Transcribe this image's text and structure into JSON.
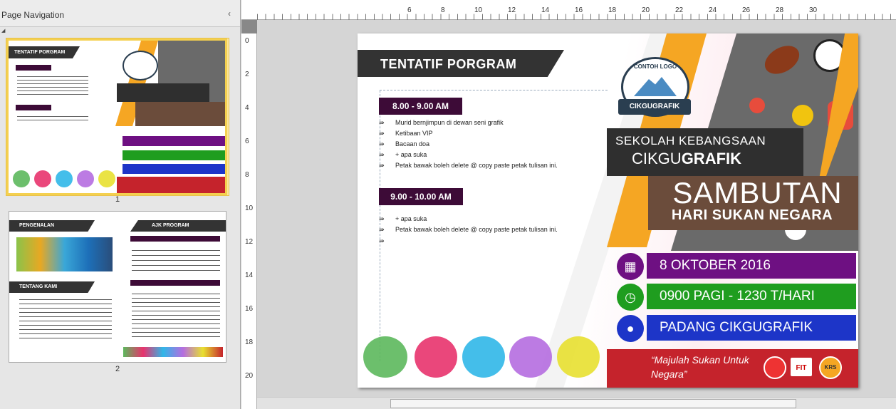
{
  "nav": {
    "title": "Page Navigation",
    "close": "‹",
    "page1": "1",
    "page2": "2"
  },
  "ruler": {
    "h": [
      "6",
      "8",
      "10",
      "12",
      "14",
      "16",
      "18",
      "20",
      "22",
      "24",
      "26",
      "28",
      "30"
    ],
    "v": [
      "0",
      "2",
      "4",
      "6",
      "8",
      "10",
      "12",
      "14",
      "16",
      "18",
      "20"
    ]
  },
  "doc": {
    "header": "TENTATIF PORGRAM",
    "slot1": {
      "time": "8.00 - 9.00 AM",
      "items": [
        "Murid bernjimpun di dewan seni grafik",
        "Ketibaan VIP",
        "Bacaan doa",
        "+ apa suka",
        "Petak bawak boleh delete @ copy paste petak tulisan ini."
      ]
    },
    "slot2": {
      "time": "9.00 - 10.00 AM",
      "items": [
        "+ apa suka",
        "Petak bawak boleh delete @ copy paste petak tulisan ini."
      ]
    },
    "logo_top": "CONTOH LOGO",
    "logo_name": "CIKGUGRAFIK",
    "school1": "SEKOLAH KEBANGSAAN",
    "school2a": "CIKGU",
    "school2b": "GRAFIK",
    "title1": "SAMBUTAN",
    "title2": "HARI SUKAN NEGARA",
    "date": "8 OKTOBER 2016",
    "time": "0900 PAGI  - 1230 T/HARI",
    "place": "PADANG CIKGUGRAFIK",
    "quote": "“Majulah Sukan Untuk Negara”",
    "sponsor_fit": "FIT",
    "sponsor_krs": "KRS"
  },
  "thumb2": {
    "h1": "PENGENALAN",
    "h2": "AJK PROGRAM",
    "h3": "TENTANG KAMI"
  },
  "colors": {
    "purple": "#6e1082",
    "green": "#1f9d1f",
    "blue": "#1d35c8",
    "red": "#c5232c",
    "brown": "#6b4c3b",
    "dark": "#333333"
  },
  "icons": {
    "calendar": "calendar-icon",
    "clock": "clock-icon",
    "pin": "location-pin-icon"
  }
}
